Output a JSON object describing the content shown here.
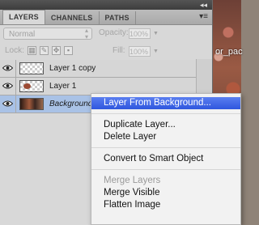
{
  "panel": {
    "tabs": [
      "LAYERS",
      "CHANNELS",
      "PATHS"
    ],
    "blend_mode": "Normal",
    "opacity_label": "Opacity:",
    "opacity_value": "100%",
    "lock_label": "Lock:",
    "fill_label": "Fill:",
    "fill_value": "100%"
  },
  "layers": [
    {
      "name": "Layer 1 copy",
      "thumb": "transparent"
    },
    {
      "name": "Layer 1",
      "thumb": "transparent-with-content"
    },
    {
      "name": "Background",
      "thumb": "photo",
      "selected": true
    }
  ],
  "context_menu": {
    "items": [
      "Layer From Background...",
      "Duplicate Layer...",
      "Delete Layer",
      "Convert to Smart Object",
      "Merge Layers",
      "Merge Visible",
      "Flatten Image"
    ]
  },
  "background": {
    "caption": "or_pac"
  },
  "icons": {
    "eye": "eye-icon",
    "panel_menu": "panel-menu-icon",
    "collapse": "collapse-icon"
  },
  "colors": {
    "highlight": "#3d62e4",
    "selection": "#a9c2e6"
  }
}
